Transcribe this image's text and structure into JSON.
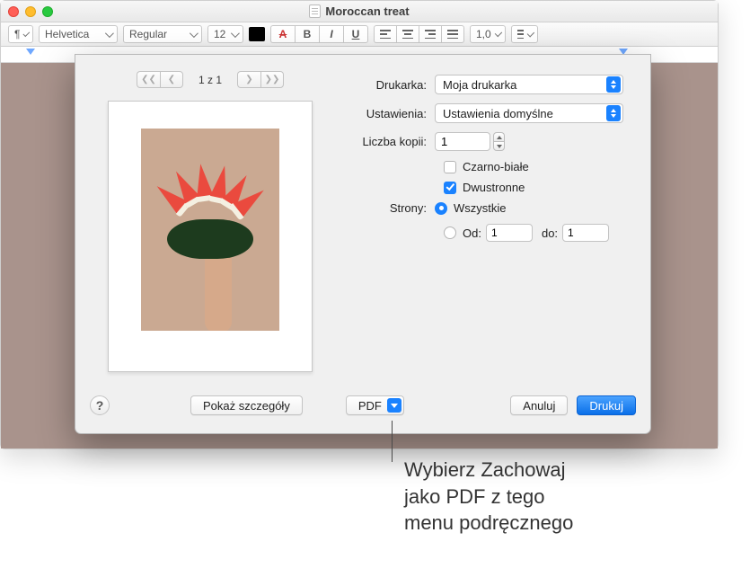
{
  "window": {
    "title": "Moroccan treat"
  },
  "toolbar": {
    "para_style_icon": "¶",
    "font": "Helvetica",
    "weight": "Regular",
    "size": "12",
    "spacing": "1,0"
  },
  "dialog": {
    "pager": {
      "first": "❮❮",
      "prev": "❮",
      "label": "1 z 1",
      "next": "❯",
      "last": "❯❯"
    },
    "labels": {
      "printer": "Drukarka:",
      "presets": "Ustawienia:",
      "copies": "Liczba kopii:",
      "bw": "Czarno-białe",
      "twosided": "Dwustronne",
      "pages": "Strony:",
      "all": "Wszystkie",
      "from": "Od:",
      "to": "do:"
    },
    "values": {
      "printer": "Moja drukarka",
      "presets": "Ustawienia domyślne",
      "copies": "1",
      "bw_checked": false,
      "twosided_checked": true,
      "pages_all_selected": true,
      "from": "1",
      "to": "1"
    },
    "buttons": {
      "help": "?",
      "details": "Pokaż szczegóły",
      "pdf": "PDF",
      "cancel": "Anuluj",
      "print": "Drukuj"
    }
  },
  "callout": "Wybierz Zachowaj jako PDF z tego menu podręcznego"
}
